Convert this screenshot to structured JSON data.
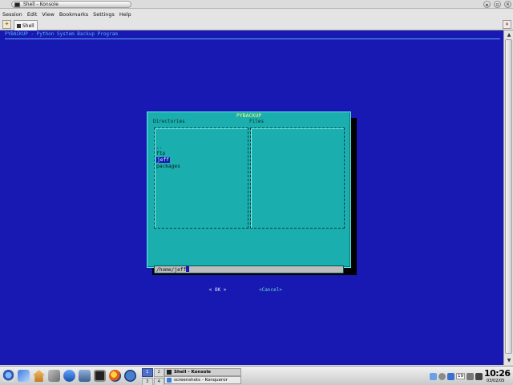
{
  "window": {
    "title": "Shell - Konsole",
    "minimize_glyph": "▴",
    "maximize_glyph": "▫",
    "close_glyph": "✕"
  },
  "menubar": {
    "items": [
      "Session",
      "Edit",
      "View",
      "Bookmarks",
      "Settings",
      "Help"
    ]
  },
  "tabs": {
    "new_tab_glyph": "✦",
    "items": [
      {
        "label": "Shell",
        "active": true
      }
    ],
    "close_glyph": "✕"
  },
  "terminal": {
    "background": "#1818b2",
    "header_text": "PYBACKUP - Python System Backup Program",
    "scroll_up_glyph": "▲",
    "scroll_down_glyph": "▼"
  },
  "dialog": {
    "title": "PYBACKUP",
    "directories_label": "Directories",
    "files_label": "Files",
    "directories": [
      {
        "name": "..",
        "selected": false
      },
      {
        "name": "ftp",
        "selected": false
      },
      {
        "name": "jeff",
        "selected": true
      },
      {
        "name": "packages",
        "selected": false
      }
    ],
    "files": [],
    "path_value": "/home/jeff",
    "ok_label": "< OK >",
    "cancel_label": "<Cancel>",
    "background": "#1aaeae",
    "title_color": "#ffff66"
  },
  "taskbar": {
    "launchers": [
      "kde-menu-icon",
      "kmail-icon",
      "home-icon",
      "settings-icon",
      "network-icon",
      "media-icon",
      "terminal-icon",
      "firefox-icon",
      "help-icon",
      "tools-icon"
    ],
    "pager": [
      "1",
      "2",
      "3",
      "4"
    ],
    "active_desktop": "1",
    "tasks": [
      {
        "label": "Shell - Konsole",
        "active": true
      },
      {
        "label": "screenshots - Konqueror",
        "active": false
      }
    ],
    "tray_number": "19",
    "clock_time": "10:26",
    "clock_date": "03/02/05"
  }
}
